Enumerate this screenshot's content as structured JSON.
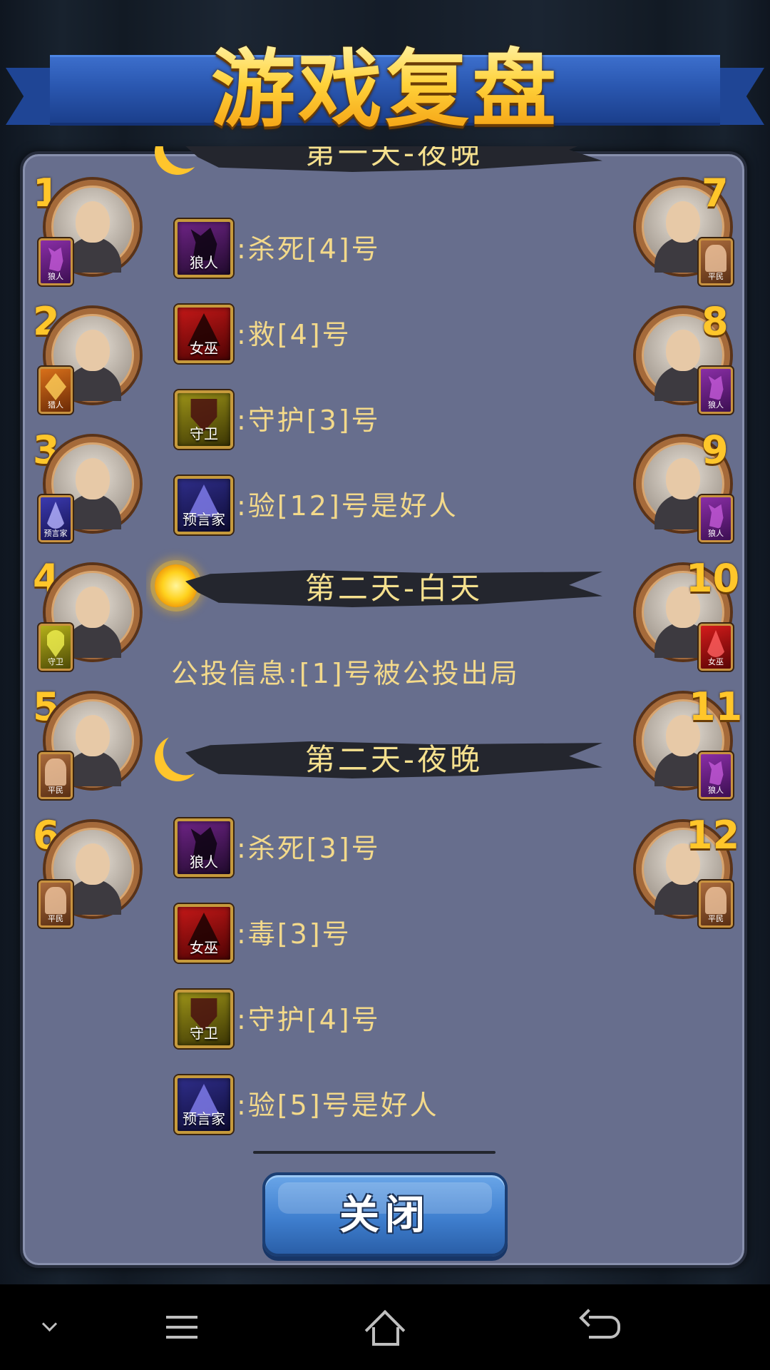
{
  "title": "游戏复盘",
  "players": [
    {
      "num": "1",
      "badge": "狼人"
    },
    {
      "num": "2",
      "badge": "猎人"
    },
    {
      "num": "3",
      "badge": "预言家"
    },
    {
      "num": "4",
      "badge": "守卫"
    },
    {
      "num": "5",
      "badge": "平民"
    },
    {
      "num": "6",
      "badge": "平民"
    },
    {
      "num": "7",
      "badge": "平民"
    },
    {
      "num": "8",
      "badge": "狼人"
    },
    {
      "num": "9",
      "badge": "狼人"
    },
    {
      "num": "10",
      "badge": "女巫"
    },
    {
      "num": "11",
      "badge": "狼人"
    },
    {
      "num": "12",
      "badge": "平民"
    }
  ],
  "log": {
    "header_top": "第一天-夜晚",
    "night1": [
      {
        "role": "狼人",
        "text": ":杀死[4]号"
      },
      {
        "role": "女巫",
        "text": ":救[4]号"
      },
      {
        "role": "守卫",
        "text": ":守护[3]号"
      },
      {
        "role": "预言家",
        "text": ":验[12]号是好人"
      }
    ],
    "day2_header": "第二天-白天",
    "vote": "公投信息:[1]号被公投出局",
    "night2_header": "第二天-夜晚",
    "night2": [
      {
        "role": "狼人",
        "text": ":杀死[3]号"
      },
      {
        "role": "女巫",
        "text": ":毒[3]号"
      },
      {
        "role": "守卫",
        "text": ":守护[4]号"
      },
      {
        "role": "预言家",
        "text": ":验[5]号是好人"
      }
    ]
  },
  "close_label": "关闭"
}
